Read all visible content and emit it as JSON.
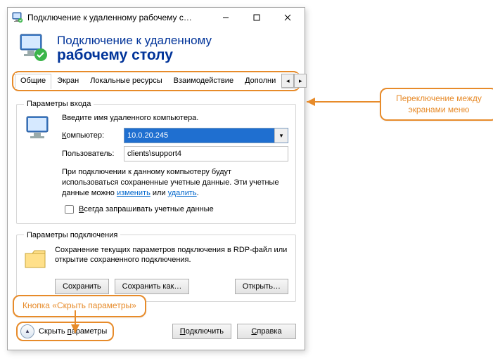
{
  "window": {
    "title": "Подключение к удаленному рабочему с…"
  },
  "header": {
    "line1": "Подключение к удаленному",
    "line2": "рабочему столу"
  },
  "tabs": {
    "items": [
      "Общие",
      "Экран",
      "Локальные ресурсы",
      "Взаимодействие",
      "Дополни"
    ]
  },
  "login": {
    "legend": "Параметры входа",
    "intro": "Введите имя удаленного компьютера.",
    "computer_label": "Компьютер:",
    "computer_value": "10.0.20.245",
    "user_label": "Пользователь:",
    "user_value": "clients\\support4",
    "note_pre": "При подключении к данному компьютеру будут использоваться сохраненные учетные данные. Эти учетные данные можно ",
    "note_link1": "изменить",
    "note_mid": " или ",
    "note_link2": "удалить",
    "note_post": ".",
    "checkbox_label": "Всегда запрашивать учетные данные"
  },
  "conn": {
    "legend": "Параметры подключения",
    "text": "Сохранение текущих параметров подключения в RDP-файл или открытие сохраненного подключения.",
    "save": "Сохранить",
    "save_as": "Сохранить как…",
    "open": "Открыть…"
  },
  "footer": {
    "hide": "Скрыть параметры",
    "connect": "Подключить",
    "help": "Справка"
  },
  "callouts": {
    "right": "Переключение между экранами меню",
    "bottom": "Кнопка «Скрыть параметры»"
  }
}
